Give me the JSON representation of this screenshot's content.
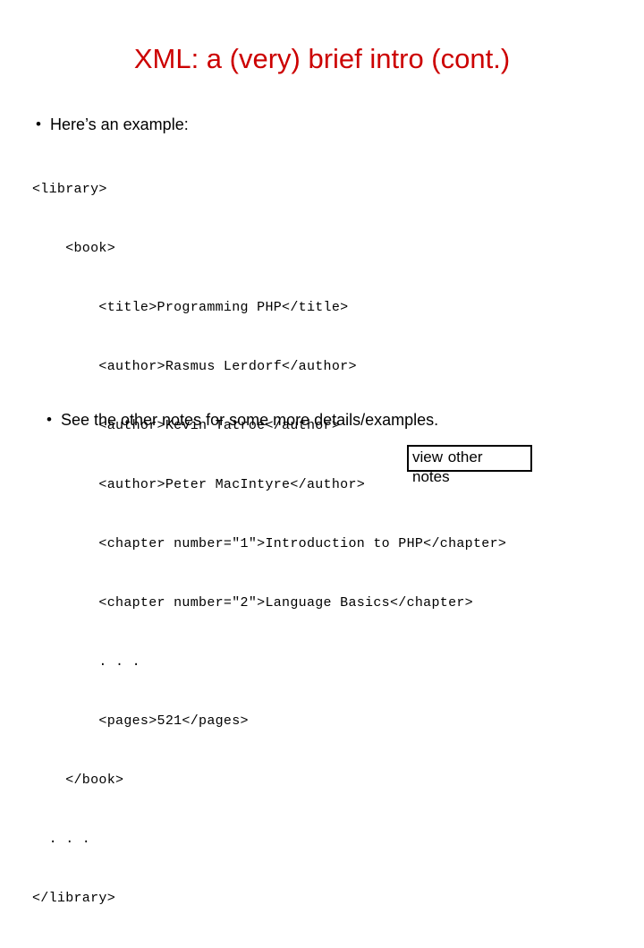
{
  "slide": {
    "title": "XML: a (very) brief intro (cont.)",
    "title_color": "#cc0000",
    "background_color": "#ffffff",
    "text_color": "#000000"
  },
  "bullets": [
    {
      "marker": "•",
      "text": "Here’s an example:"
    },
    {
      "marker": "•",
      "text": "See the other notes for some more details/examples."
    }
  ],
  "code": {
    "language": "xml",
    "lines": [
      "<library>",
      "    <book>",
      "        <title>Programming PHP</title>",
      "        <author>Rasmus Lerdorf</author>",
      "        <author>Kevin Tatroe</author>",
      "        <author>Peter MacIntyre</author>",
      "        <chapter number=\"1\">Introduction to PHP</chapter>",
      "        <chapter number=\"2\">Language Basics</chapter>",
      "        . . .",
      "        <pages>521</pages>",
      "    </book>",
      "  . . .",
      "</library>"
    ]
  },
  "view_notes_button": {
    "label": "view other notes",
    "border_color": "#000000",
    "background_color": "#ffffff"
  }
}
